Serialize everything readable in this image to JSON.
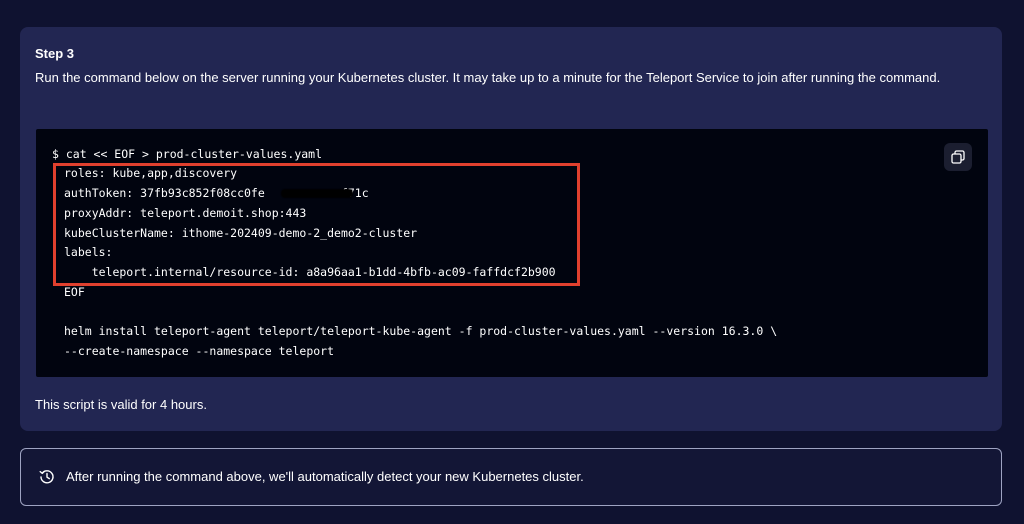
{
  "step": {
    "title": "Step 3",
    "description": "Run the command below on the server running your Kubernetes cluster. It may take up to a minute for the Teleport Service to join after running the command.",
    "validity": "This script is valid for 4 hours."
  },
  "code": {
    "copy_icon": "copy-icon",
    "lines": [
      "$ cat << EOF > prod-cluster-values.yaml",
      "roles: kube,app,discovery",
      "authToken: 37fb93c852f08cc0fe           f71c",
      "proxyAddr: teleport.demoit.shop:443",
      "kubeClusterName: ithome-202409-demo-2_demo2-cluster",
      "labels:",
      "    teleport.internal/resource-id: a8a96aa1-b1dd-4bfb-ac09-faffdcf2b900",
      "EOF",
      "",
      "helm install teleport-agent teleport/teleport-kube-agent -f prod-cluster-values.yaml --version 16.3.0 \\",
      "--create-namespace --namespace teleport"
    ]
  },
  "notice": {
    "icon": "history-icon",
    "text": "After running the command above, we'll automatically detect your new Kubernetes cluster."
  },
  "colors": {
    "page_bg": "#0f1230",
    "card_bg": "#222652",
    "code_bg": "#01040f",
    "highlight": "#e0402e"
  }
}
